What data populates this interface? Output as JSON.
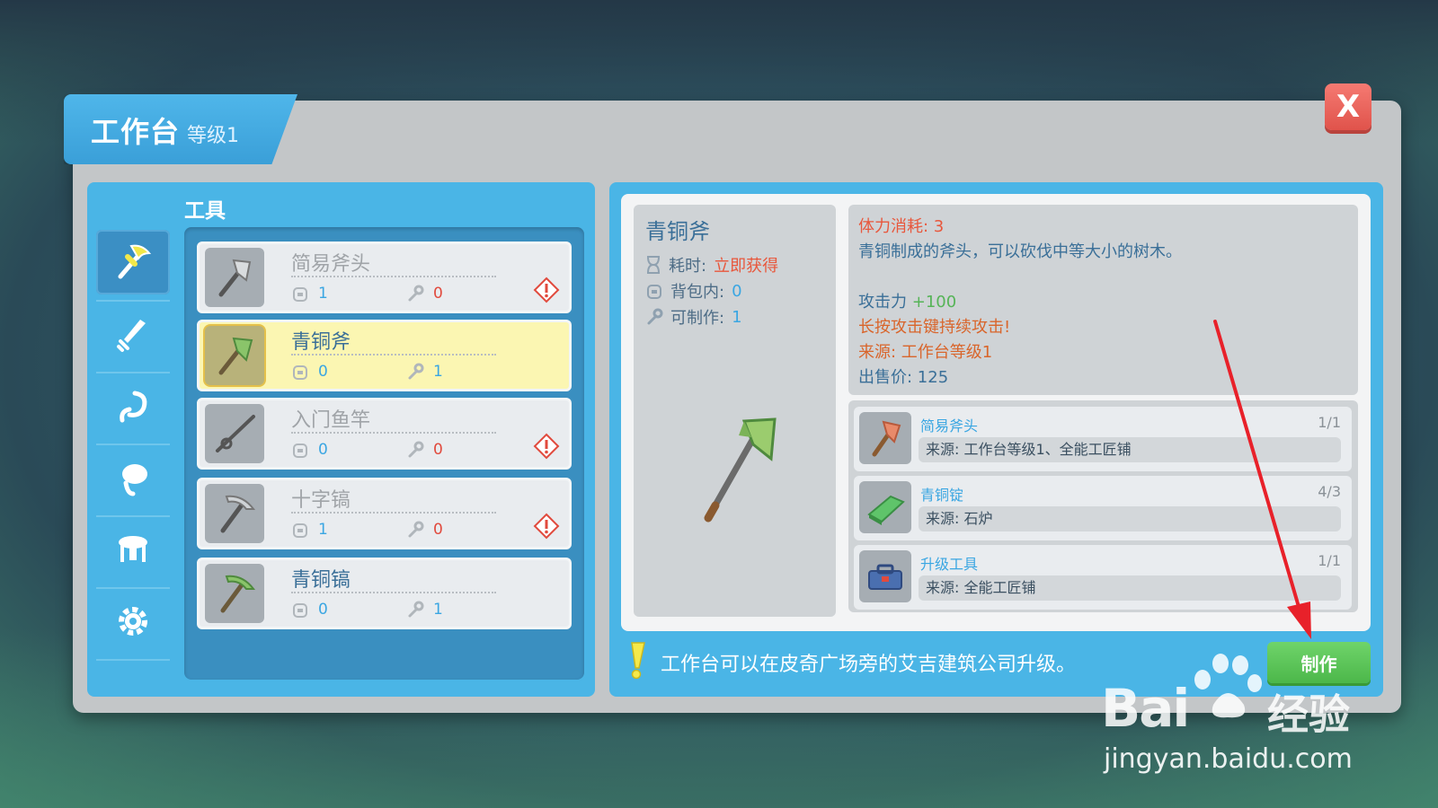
{
  "window": {
    "title": "工作台",
    "level": "等级1",
    "close_label": "X"
  },
  "left": {
    "category": "工具",
    "side_tabs": [
      {
        "icon": "axe-pick-icon",
        "active": true
      },
      {
        "icon": "sword-icon",
        "active": false
      },
      {
        "icon": "hook-icon",
        "active": false
      },
      {
        "icon": "pot-icon",
        "active": false
      },
      {
        "icon": "furniture-icon",
        "active": false
      },
      {
        "icon": "gear-icon",
        "active": false
      }
    ],
    "items": [
      {
        "name": "简易斧头",
        "bag": "1",
        "craftable": "0",
        "warning": true,
        "selected": false,
        "available": false
      },
      {
        "name": "青铜斧",
        "bag": "0",
        "craftable": "1",
        "warning": false,
        "selected": true,
        "available": true
      },
      {
        "name": "入门鱼竿",
        "bag": "0",
        "craftable": "0",
        "warning": true,
        "selected": false,
        "available": false
      },
      {
        "name": "十字镐",
        "bag": "1",
        "craftable": "0",
        "warning": true,
        "selected": false,
        "available": false
      },
      {
        "name": "青铜镐",
        "bag": "0",
        "craftable": "1",
        "warning": false,
        "selected": false,
        "available": true
      }
    ]
  },
  "detail": {
    "name": "青铜斧",
    "time_label": "耗时:",
    "time_value": "立即获得",
    "bag_label": "背包内:",
    "bag_value": "0",
    "craft_label": "可制作:",
    "craft_value": "1",
    "stamina": "体力消耗: 3",
    "desc": "青铜制成的斧头，可以砍伐中等大小的树木。",
    "attack_label": "攻击力",
    "attack_value": "+100",
    "hold_tip": "长按攻击键持续攻击!",
    "source": "来源: 工作台等级1",
    "price": "出售价: 125"
  },
  "materials": [
    {
      "name": "简易斧头",
      "count": "1/1",
      "source": "来源: 工作台等级1、全能工匠铺",
      "icon": "axe-icon"
    },
    {
      "name": "青铜锭",
      "count": "4/3",
      "source": "来源: 石炉",
      "icon": "ingot-icon"
    },
    {
      "name": "升级工具",
      "count": "1/1",
      "source": "来源: 全能工匠铺",
      "icon": "toolbox-icon"
    }
  ],
  "footer": {
    "hint": "工作台可以在皮奇广场旁的艾吉建筑公司升级。",
    "make_label": "制作"
  },
  "watermark": {
    "brand": "Bai",
    "brand2": "经验",
    "url": "jingyan.baidu.com"
  },
  "colors": {
    "panel_blue": "#4ab5e6",
    "make_green": "#56c153",
    "close_red": "#e8605a",
    "selected_yellow": "#fbf6b2"
  }
}
